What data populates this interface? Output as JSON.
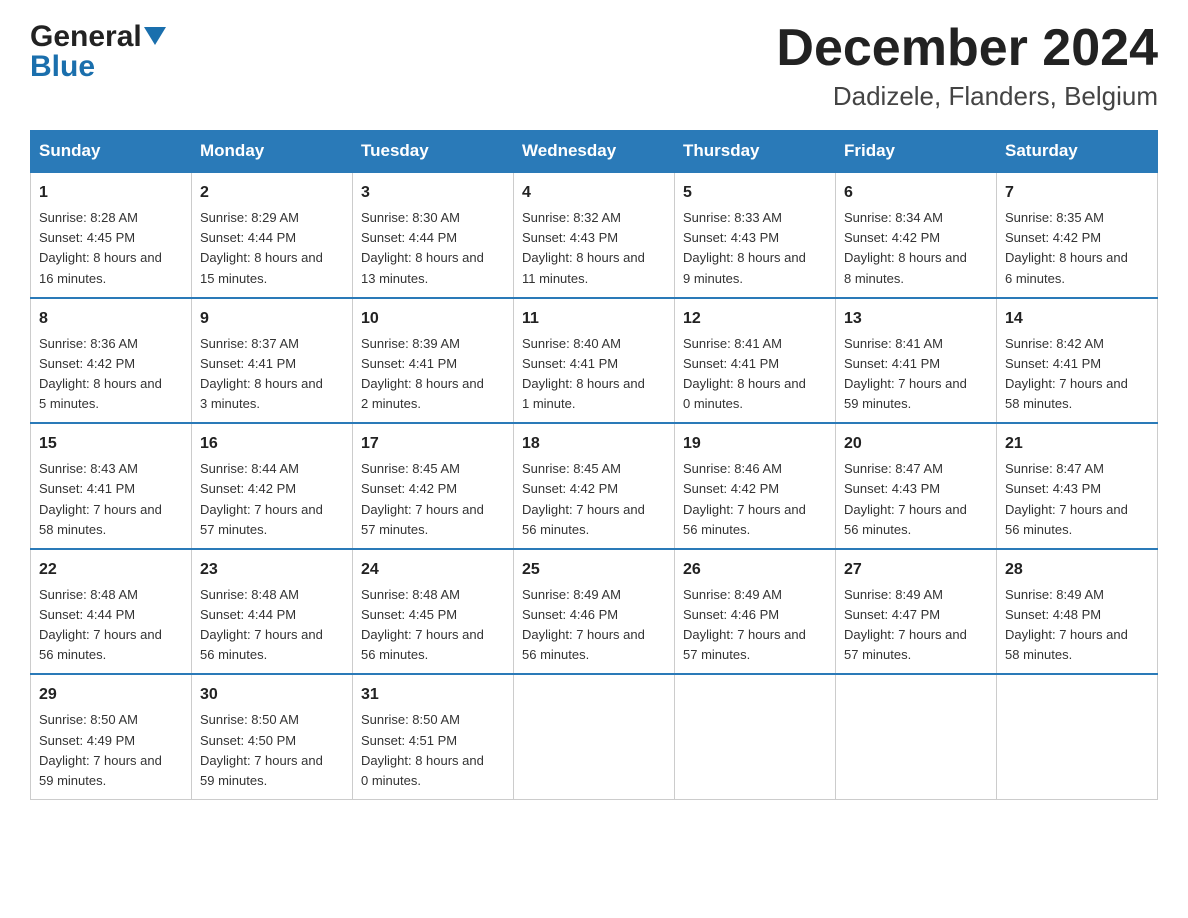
{
  "header": {
    "logo_line1": "General",
    "logo_line2": "Blue",
    "month": "December 2024",
    "location": "Dadizele, Flanders, Belgium"
  },
  "days_of_week": [
    "Sunday",
    "Monday",
    "Tuesday",
    "Wednesday",
    "Thursday",
    "Friday",
    "Saturday"
  ],
  "weeks": [
    [
      {
        "day": "1",
        "sunrise": "8:28 AM",
        "sunset": "4:45 PM",
        "daylight": "8 hours and 16 minutes."
      },
      {
        "day": "2",
        "sunrise": "8:29 AM",
        "sunset": "4:44 PM",
        "daylight": "8 hours and 15 minutes."
      },
      {
        "day": "3",
        "sunrise": "8:30 AM",
        "sunset": "4:44 PM",
        "daylight": "8 hours and 13 minutes."
      },
      {
        "day": "4",
        "sunrise": "8:32 AM",
        "sunset": "4:43 PM",
        "daylight": "8 hours and 11 minutes."
      },
      {
        "day": "5",
        "sunrise": "8:33 AM",
        "sunset": "4:43 PM",
        "daylight": "8 hours and 9 minutes."
      },
      {
        "day": "6",
        "sunrise": "8:34 AM",
        "sunset": "4:42 PM",
        "daylight": "8 hours and 8 minutes."
      },
      {
        "day": "7",
        "sunrise": "8:35 AM",
        "sunset": "4:42 PM",
        "daylight": "8 hours and 6 minutes."
      }
    ],
    [
      {
        "day": "8",
        "sunrise": "8:36 AM",
        "sunset": "4:42 PM",
        "daylight": "8 hours and 5 minutes."
      },
      {
        "day": "9",
        "sunrise": "8:37 AM",
        "sunset": "4:41 PM",
        "daylight": "8 hours and 3 minutes."
      },
      {
        "day": "10",
        "sunrise": "8:39 AM",
        "sunset": "4:41 PM",
        "daylight": "8 hours and 2 minutes."
      },
      {
        "day": "11",
        "sunrise": "8:40 AM",
        "sunset": "4:41 PM",
        "daylight": "8 hours and 1 minute."
      },
      {
        "day": "12",
        "sunrise": "8:41 AM",
        "sunset": "4:41 PM",
        "daylight": "8 hours and 0 minutes."
      },
      {
        "day": "13",
        "sunrise": "8:41 AM",
        "sunset": "4:41 PM",
        "daylight": "7 hours and 59 minutes."
      },
      {
        "day": "14",
        "sunrise": "8:42 AM",
        "sunset": "4:41 PM",
        "daylight": "7 hours and 58 minutes."
      }
    ],
    [
      {
        "day": "15",
        "sunrise": "8:43 AM",
        "sunset": "4:41 PM",
        "daylight": "7 hours and 58 minutes."
      },
      {
        "day": "16",
        "sunrise": "8:44 AM",
        "sunset": "4:42 PM",
        "daylight": "7 hours and 57 minutes."
      },
      {
        "day": "17",
        "sunrise": "8:45 AM",
        "sunset": "4:42 PM",
        "daylight": "7 hours and 57 minutes."
      },
      {
        "day": "18",
        "sunrise": "8:45 AM",
        "sunset": "4:42 PM",
        "daylight": "7 hours and 56 minutes."
      },
      {
        "day": "19",
        "sunrise": "8:46 AM",
        "sunset": "4:42 PM",
        "daylight": "7 hours and 56 minutes."
      },
      {
        "day": "20",
        "sunrise": "8:47 AM",
        "sunset": "4:43 PM",
        "daylight": "7 hours and 56 minutes."
      },
      {
        "day": "21",
        "sunrise": "8:47 AM",
        "sunset": "4:43 PM",
        "daylight": "7 hours and 56 minutes."
      }
    ],
    [
      {
        "day": "22",
        "sunrise": "8:48 AM",
        "sunset": "4:44 PM",
        "daylight": "7 hours and 56 minutes."
      },
      {
        "day": "23",
        "sunrise": "8:48 AM",
        "sunset": "4:44 PM",
        "daylight": "7 hours and 56 minutes."
      },
      {
        "day": "24",
        "sunrise": "8:48 AM",
        "sunset": "4:45 PM",
        "daylight": "7 hours and 56 minutes."
      },
      {
        "day": "25",
        "sunrise": "8:49 AM",
        "sunset": "4:46 PM",
        "daylight": "7 hours and 56 minutes."
      },
      {
        "day": "26",
        "sunrise": "8:49 AM",
        "sunset": "4:46 PM",
        "daylight": "7 hours and 57 minutes."
      },
      {
        "day": "27",
        "sunrise": "8:49 AM",
        "sunset": "4:47 PM",
        "daylight": "7 hours and 57 minutes."
      },
      {
        "day": "28",
        "sunrise": "8:49 AM",
        "sunset": "4:48 PM",
        "daylight": "7 hours and 58 minutes."
      }
    ],
    [
      {
        "day": "29",
        "sunrise": "8:50 AM",
        "sunset": "4:49 PM",
        "daylight": "7 hours and 59 minutes."
      },
      {
        "day": "30",
        "sunrise": "8:50 AM",
        "sunset": "4:50 PM",
        "daylight": "7 hours and 59 minutes."
      },
      {
        "day": "31",
        "sunrise": "8:50 AM",
        "sunset": "4:51 PM",
        "daylight": "8 hours and 0 minutes."
      },
      null,
      null,
      null,
      null
    ]
  ],
  "labels": {
    "sunrise": "Sunrise:",
    "sunset": "Sunset:",
    "daylight": "Daylight:"
  }
}
